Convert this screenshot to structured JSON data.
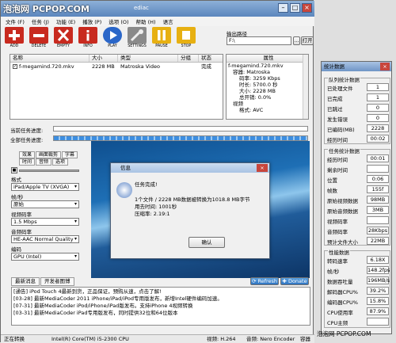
{
  "watermark": {
    "top_left": "泡泡网 PCPOP.COM",
    "bottom_right": "泡泡网 PCPOP.COM"
  },
  "window": {
    "title": "ediac"
  },
  "menu": [
    "文件 (F)",
    "任务 (J)",
    "功能 (E)",
    "播放 (P)",
    "选项 (O)",
    "帮助 (H)",
    "语言"
  ],
  "toolbar": [
    {
      "label": "ADD",
      "icon": "add-icon",
      "color": "#c82a1f"
    },
    {
      "label": "DELETE",
      "icon": "delete-icon",
      "color": "#c82a1f"
    },
    {
      "label": "EMPTY",
      "icon": "empty-icon",
      "color": "#c82a1f"
    },
    {
      "label": "INFO",
      "icon": "info-icon",
      "color": "#c82a1f"
    },
    {
      "label": "PLAY",
      "icon": "play-icon",
      "color": "#2a66c8"
    },
    {
      "label": "SETTINGS",
      "icon": "settings-icon",
      "color": "#7a7a7a"
    },
    {
      "label": "PAUSE",
      "icon": "pause-icon",
      "color": "#e7b012"
    },
    {
      "label": "STOP",
      "icon": "stop-icon",
      "color": "#e7b012"
    }
  ],
  "output": {
    "label": "输出路径",
    "value": "F:\\",
    "browse_small": "...",
    "open": "打开"
  },
  "file_list": {
    "headers": [
      "名称",
      "大小",
      "类型",
      "分组",
      "状态"
    ],
    "rows": [
      {
        "name": "f-megamind.720.mkv",
        "size": "2228 MB",
        "type": "Matroska Video",
        "group": "",
        "status": "完成",
        "checked": true
      }
    ]
  },
  "properties": {
    "header": "属性",
    "lines": [
      "f-megamind.720.mkv",
      "容器: Matroska",
      "码率: 3259 Kbps",
      "时长: 5700.0 秒",
      "大小: 2228 MB",
      "总开销: 0.0%",
      "视频",
      "格式: AVC"
    ]
  },
  "progress": {
    "current_label": "当前任务进度:",
    "total_label": "全部任务进度:",
    "current_value": 0,
    "total_value": 1
  },
  "left_tabs_row1": [
    "效果",
    "画面裁剪",
    "字幕"
  ],
  "left_tabs_row2": [
    "时间",
    "音频",
    "选项"
  ],
  "format": {
    "label": "格式",
    "value": "iPad/Apple TV (XVGA)"
  },
  "framerate": {
    "label": "帧/秒",
    "value": "原始"
  },
  "video_bitrate": {
    "label": "视频码率",
    "value": "1.5 Mbps"
  },
  "audio_bitrate": {
    "label": "音频码率",
    "value": "HE-AAC Normal Quality"
  },
  "encode": {
    "label": "编码",
    "value": "GPU (Intel)"
  },
  "dialog": {
    "title": "信息",
    "heading": "任务完成!",
    "line1": "1个文件 / 2228 MB数据被转换为1018.8 MB字节",
    "line2": "用去时间: 1001秒",
    "line3": "压缩率: 2.19:1",
    "ok": "确认"
  },
  "news": {
    "tabs": [
      "最新消息",
      "开发者图博"
    ],
    "refresh": "Refresh",
    "donate": "Donate",
    "items": [
      "[通告] iPod Touch 4最新到货，正品保证，预购从速，点击了解!",
      "[03-28] 最新MediaCoder 2011 iPhone/iPad/iPod专用版发布，新增Intel硬件编码加速。",
      "[07-31] 最新MediaCoder iPod/iPhone/iPad版发布。支持iPhone 4视频转换",
      "[03-31] 最新MediaCoder iPad专用版发布，同时提供32位和64位版本"
    ]
  },
  "statusbar": [
    "正在转换",
    "Intel(R) Core(TM) i5-2300 CPU",
    "视频: H.264",
    "音频: Nero Encoder",
    "容器"
  ],
  "stats": {
    "title": "统计数据",
    "queue": {
      "title": "队列统计数据",
      "rows": [
        {
          "label": "已处理文件",
          "value": "1"
        },
        {
          "label": "已完成",
          "value": "1"
        },
        {
          "label": "已跳过",
          "value": "0"
        },
        {
          "label": "发生错误",
          "value": "0"
        },
        {
          "label": "已编码(MB)",
          "value": "2228"
        },
        {
          "label": "经历时间",
          "value": "00:02"
        }
      ]
    },
    "task": {
      "title": "任务统计数据",
      "rows": [
        {
          "label": "经历时间",
          "value": "00:01"
        },
        {
          "label": "剩余时间",
          "value": ""
        },
        {
          "label": "位置",
          "value": "0:06"
        },
        {
          "label": "帧数",
          "value": "155f"
        },
        {
          "label": "原始视频数据",
          "value": "98MB"
        },
        {
          "label": "原始音频数据",
          "value": "3MB"
        },
        {
          "label": "视频码率",
          "value": ""
        },
        {
          "label": "音频码率",
          "value": "28Kbps"
        },
        {
          "label": "预计文件大小",
          "value": "22MB"
        }
      ]
    },
    "perf": {
      "title": "性能数据",
      "rows": [
        {
          "label": "转码速率",
          "value": "6.18X"
        },
        {
          "label": "帧/秒",
          "value": "148.2fps"
        },
        {
          "label": "数据吞吐量",
          "value": "196MB/s"
        },
        {
          "label": "解码器CPU%",
          "value": "39.2%"
        },
        {
          "label": "编码器CPU%",
          "value": "15.8%"
        },
        {
          "label": "CPU使用率",
          "value": "87.9%"
        },
        {
          "label": "CPU主频",
          "value": ""
        }
      ]
    }
  }
}
